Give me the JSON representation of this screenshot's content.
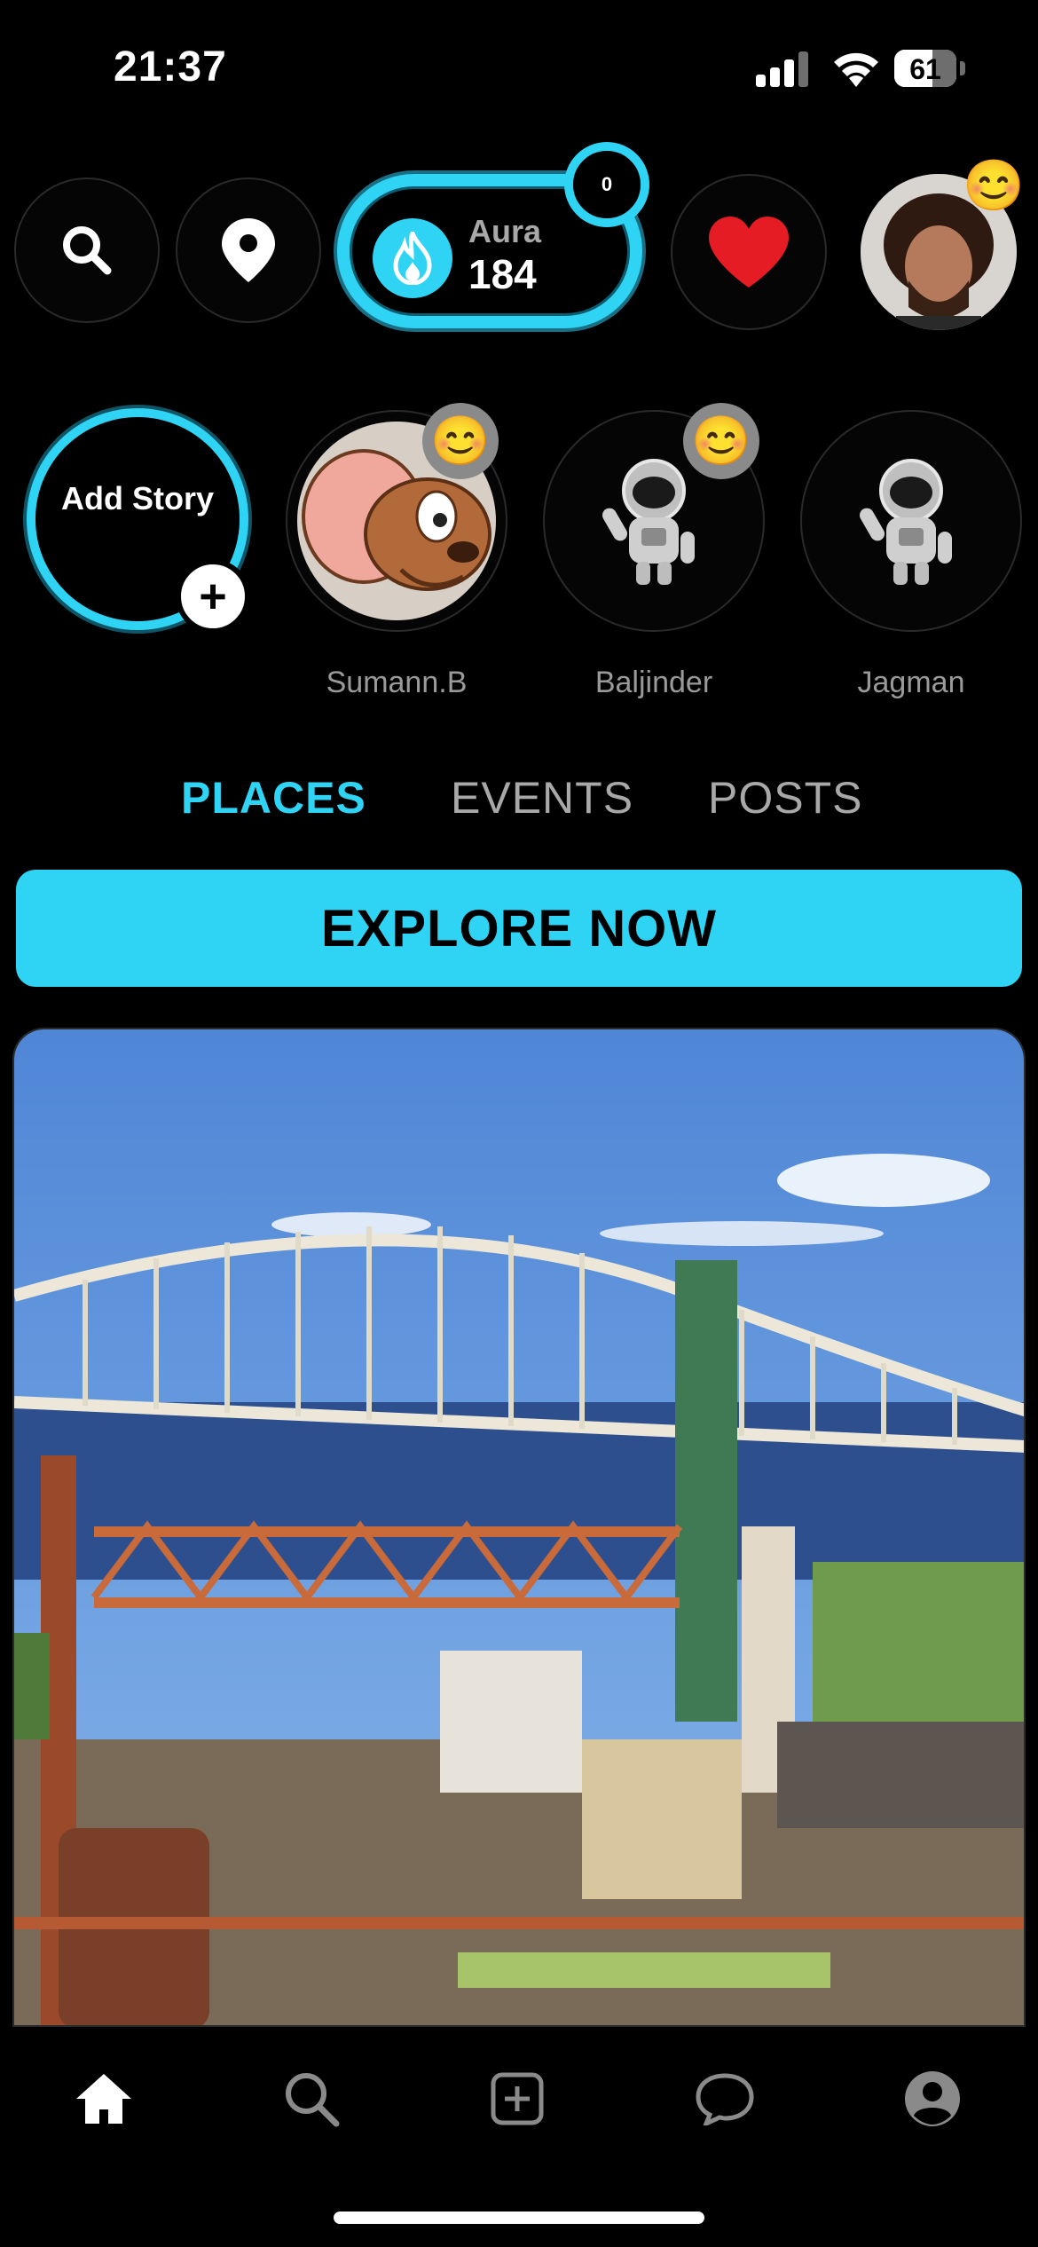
{
  "status_bar": {
    "time": "21:37",
    "battery": "61",
    "battery_level": 0.61
  },
  "top_bar": {
    "aura": {
      "label": "Aura",
      "value": "184",
      "badge": "0"
    },
    "profile_emoji": "😊"
  },
  "stories": {
    "add_story_label": "Add Story",
    "add_story_plus": "+",
    "items": [
      {
        "name": "Sumann.B",
        "emoji": "😊",
        "avatar": "jerry-mouse"
      },
      {
        "name": "Baljinder",
        "emoji": "😊",
        "avatar": "astronaut"
      },
      {
        "name": "Jagman",
        "emoji": "",
        "avatar": "astronaut"
      }
    ]
  },
  "tabs": [
    {
      "label": "PLACES",
      "active": true
    },
    {
      "label": "EVENTS",
      "active": false
    },
    {
      "label": "POSTS",
      "active": false
    }
  ],
  "explore_button": "EXPLORE NOW",
  "colors": {
    "accent": "#2fd4f5",
    "like": "#e51c23",
    "background": "#000000"
  },
  "bottom_nav": [
    "home-icon",
    "search-icon",
    "add-post-icon",
    "chat-icon",
    "profile-icon"
  ]
}
